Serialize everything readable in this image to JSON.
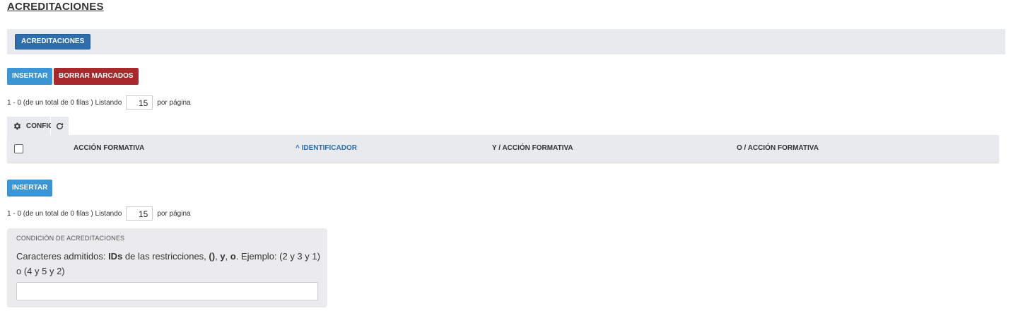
{
  "page": {
    "title": "ACREDITACIONES"
  },
  "tabs": [
    {
      "label": "ACREDITACIONES"
    }
  ],
  "actions": {
    "insert_label": "INSERTAR",
    "delete_marked_label": "BORRAR MARCADOS"
  },
  "pager_top": {
    "summary": "1 - 0 (de un total de 0 filas ) Listando",
    "per_page": "15",
    "per_page_suffix": "por página"
  },
  "toolbar": {
    "config_label": "CONFIG"
  },
  "table": {
    "columns": [
      {
        "label": "ACCIÓN FORMATIVA",
        "sorted": false
      },
      {
        "label": "^ IDENTIFICADOR",
        "sorted": true
      },
      {
        "label": "Y / ACCIÓN FORMATIVA",
        "sorted": false
      },
      {
        "label": "O / ACCIÓN FORMATIVA",
        "sorted": false
      }
    ]
  },
  "bottom_actions": {
    "insert_label": "INSERTAR"
  },
  "pager_bottom": {
    "summary": "1 - 0 (de un total de 0 filas ) Listando",
    "per_page": "15",
    "per_page_suffix": "por página"
  },
  "condition": {
    "title": "CONDICIÓN DE ACREDITACIONES",
    "desc_prefix": "Caracteres admitidos: ",
    "desc_ids": "IDs",
    "desc_mid1": " de las restricciones, ",
    "desc_parens": "()",
    "desc_comma": ", ",
    "desc_y": "y",
    "desc_comma2": ", ",
    "desc_o": "o",
    "desc_suffix": ". Ejemplo: (2 y 3 y 1) o (4 y 5 y 2)",
    "input_value": ""
  },
  "colors": {
    "primary": "#2e6ead",
    "insert": "#3a96d5",
    "danger": "#a8292b",
    "panel": "#e9eaed"
  },
  "icons": {
    "config": "gear-icon",
    "refresh": "refresh-icon"
  }
}
